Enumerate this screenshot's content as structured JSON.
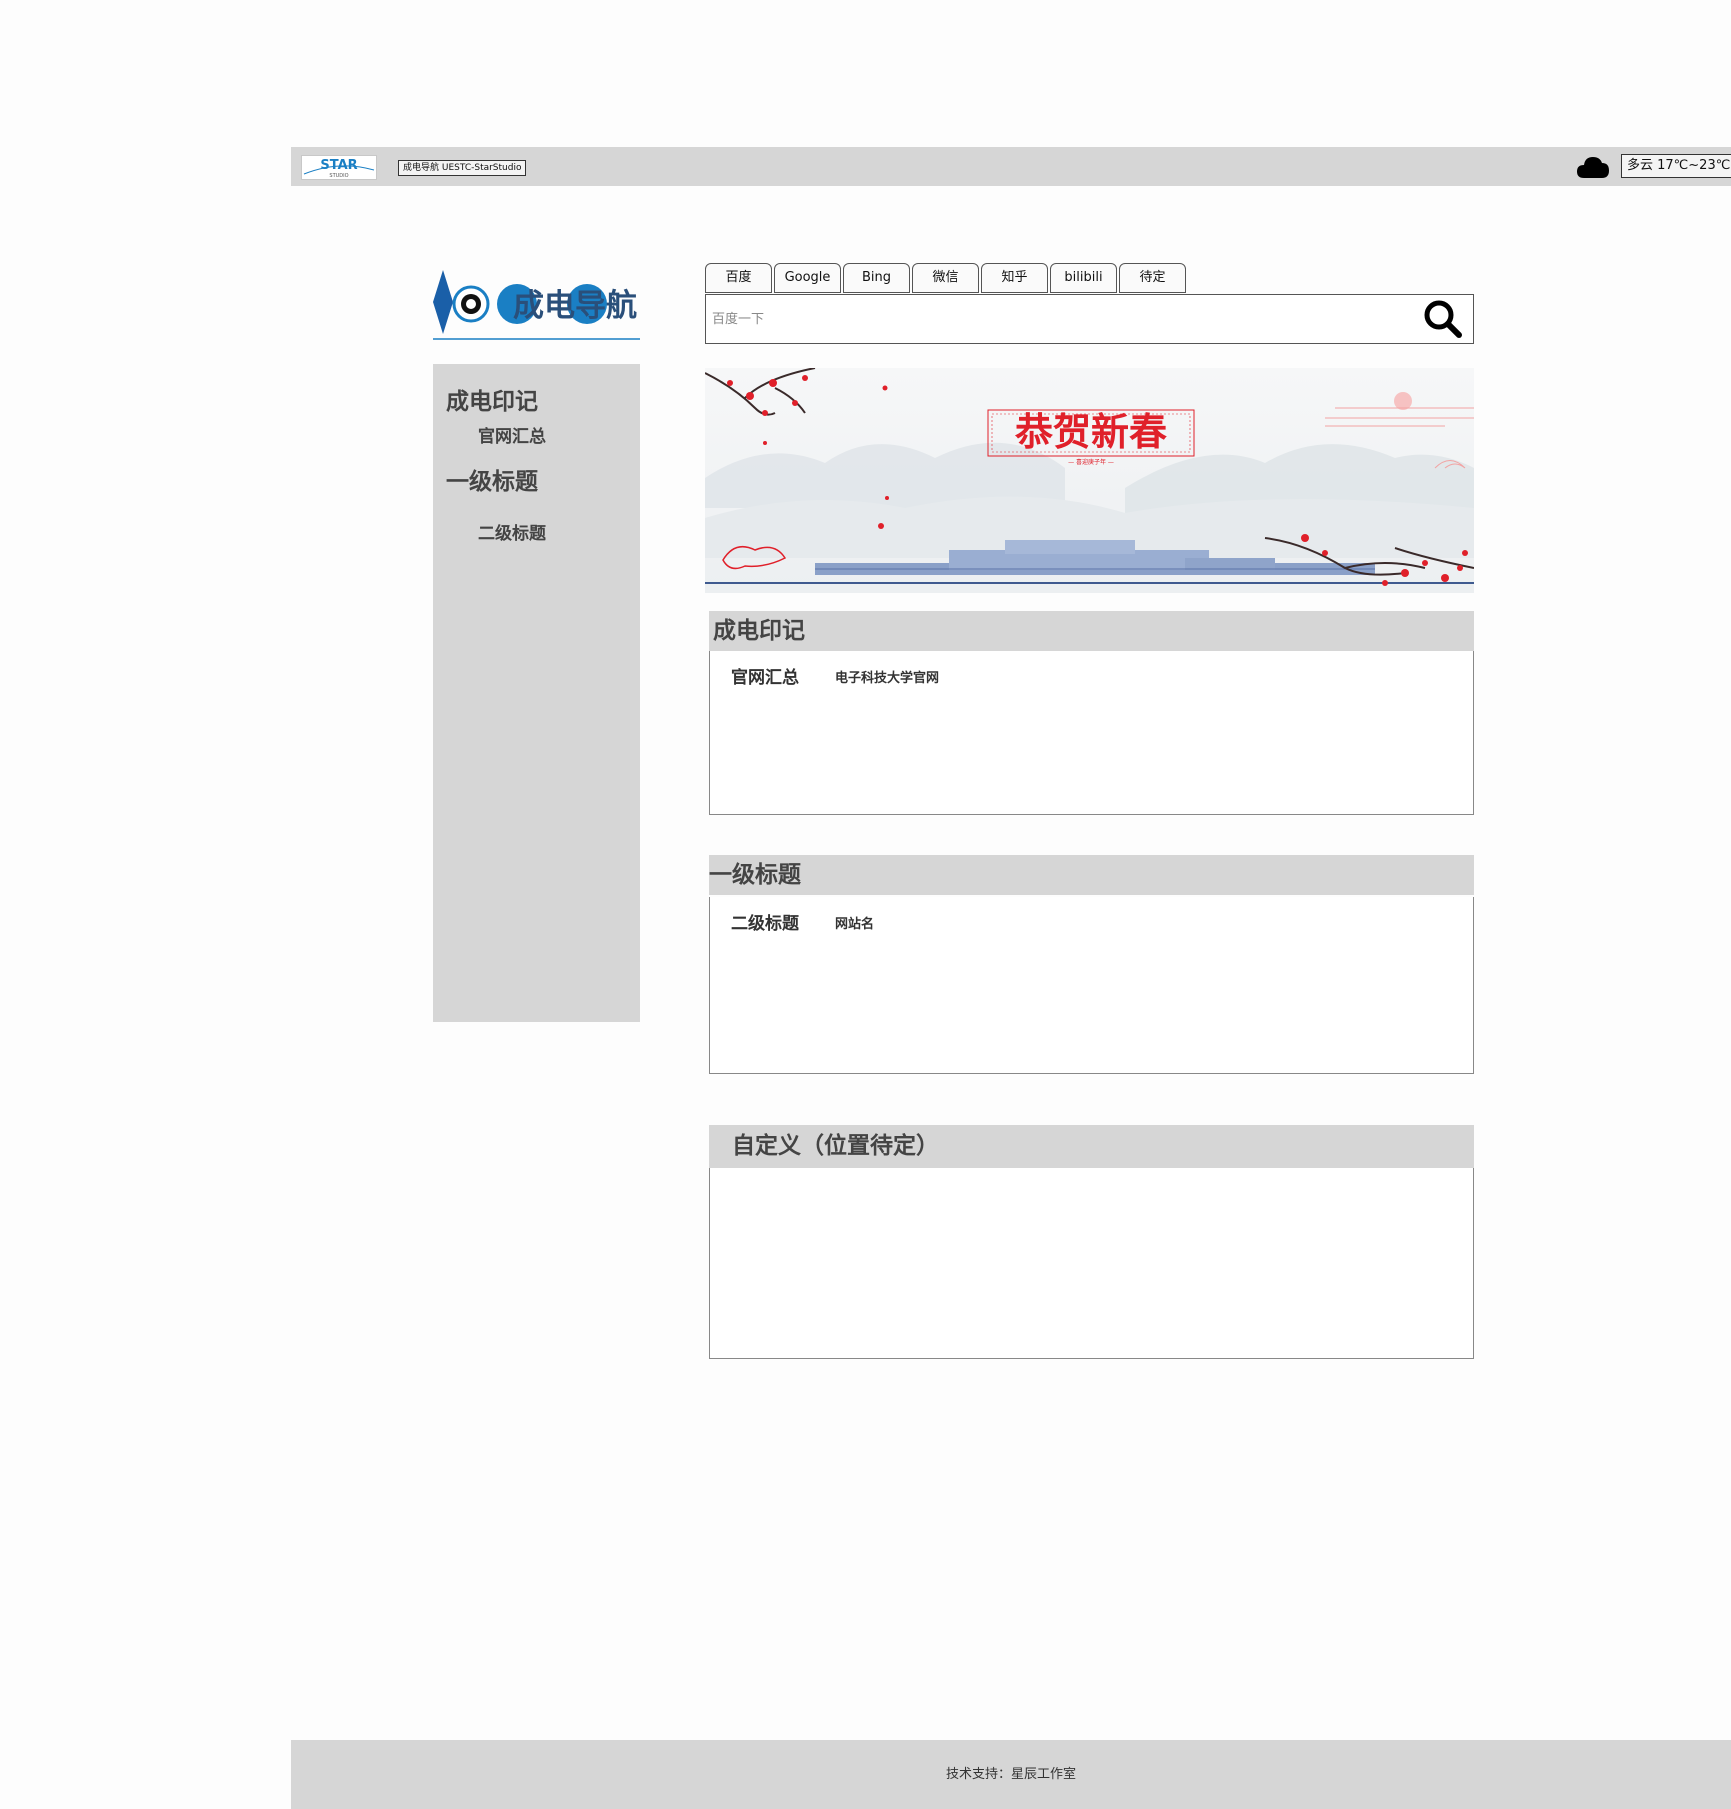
{
  "topbar": {
    "star_logo_text": "STAR",
    "star_logo_subtext": "STUDIO",
    "site_title": "成电导航  UESTC-StarStudio",
    "weather_icon": "cloud-icon",
    "weather_text": "多云  17℃~23℃"
  },
  "brand": {
    "logo_text": "成电导航"
  },
  "sidebar": {
    "items": [
      {
        "level": 1,
        "label": "成电印记"
      },
      {
        "level": 2,
        "label": "官网汇总"
      },
      {
        "level": 1,
        "label": "一级标题"
      },
      {
        "level": 2,
        "label": "二级标题"
      }
    ]
  },
  "search": {
    "engines": [
      "百度",
      "Google",
      "Bing",
      "微信",
      "知乎",
      "bilibili",
      "待定"
    ],
    "placeholder": "百度一下",
    "value": "",
    "icon": "search-icon"
  },
  "banner": {
    "title": "恭贺新春",
    "subtitle": "— 喜迎庚子年 —"
  },
  "sections": [
    {
      "title": "成电印记",
      "subsections": [
        {
          "label": "官网汇总",
          "links": [
            "电子科技大学官网"
          ]
        }
      ]
    },
    {
      "title": "一级标题",
      "subsections": [
        {
          "label": "二级标题",
          "links": [
            "网站名"
          ]
        }
      ]
    },
    {
      "title": "自定义（位置待定）",
      "subsections": []
    }
  ],
  "footer": {
    "text": "技术支持：星辰工作室"
  },
  "colors": {
    "panel_gray": "#d6d6d6",
    "brand_blue": "#1a7fc4",
    "banner_red": "#e0202a"
  }
}
